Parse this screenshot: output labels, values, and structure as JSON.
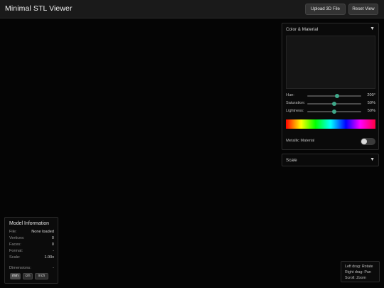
{
  "header": {
    "title": "Minimal STL Viewer",
    "upload_label": "Upload 3D File",
    "reset_label": "Reset View"
  },
  "color_panel": {
    "title": "Color & Material",
    "arrow": "▼",
    "hue": {
      "label": "Hue:",
      "value": "200°",
      "fraction": 0.55
    },
    "saturation": {
      "label": "Saturation:",
      "value": "50%",
      "fraction": 0.5
    },
    "lightness": {
      "label": "Lightness:",
      "value": "50%",
      "fraction": 0.5
    },
    "metallic_label": "Metallic Material",
    "metallic_on": false,
    "accent_color": "#3fa88a"
  },
  "scale_panel": {
    "title": "Scale",
    "arrow": "▼"
  },
  "model_info": {
    "title": "Model Information",
    "rows": [
      {
        "label": "File:",
        "value": "None loaded"
      },
      {
        "label": "Vertices:",
        "value": "0"
      },
      {
        "label": "Faces:",
        "value": "0"
      },
      {
        "label": "Format:",
        "value": "-"
      },
      {
        "label": "Scale:",
        "value": "1.00x"
      }
    ],
    "dimensions": {
      "label": "Dimensions:",
      "value": "-"
    },
    "units": [
      "mm",
      "cm",
      "inch"
    ],
    "selected_unit": "mm"
  },
  "help": {
    "lines": [
      "Left drag: Rotate",
      "Right drag: Pan",
      "Scroll: Zoom"
    ]
  }
}
